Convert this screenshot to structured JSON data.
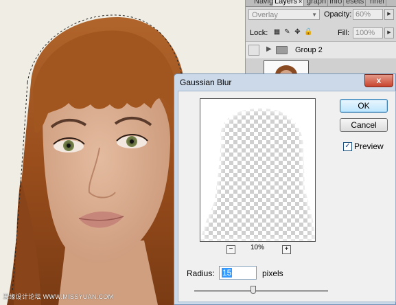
{
  "panel": {
    "tabs": [
      "Navig",
      "Layers",
      "graph",
      "Info",
      "esets",
      "rinel"
    ],
    "active_tab_close": "×",
    "blend_mode": "Overlay",
    "opacity_label": "Opacity:",
    "opacity_value": "60%",
    "lock_label": "Lock:",
    "fill_label": "Fill:",
    "fill_value": "100%",
    "layer_name": "Group 2"
  },
  "dialog": {
    "title": "Gaussian Blur",
    "close_label": "x",
    "ok_label": "OK",
    "cancel_label": "Cancel",
    "preview_label": "Preview",
    "preview_checked": true,
    "zoom_minus": "−",
    "zoom_plus": "+",
    "zoom_value": "10%",
    "radius_label": "Radius:",
    "radius_value": "15",
    "radius_unit": "pixels",
    "radius_slider_fraction": 0.44
  },
  "watermark": "思缘设计论坛  WWW.MISSYUAN.COM",
  "colors": {
    "dialog_frame": "#ccd9e8",
    "close_red": "#c8452e",
    "selection_blue": "#3399ff",
    "hair": "#a55a24",
    "skin": "#d8ab8d"
  }
}
